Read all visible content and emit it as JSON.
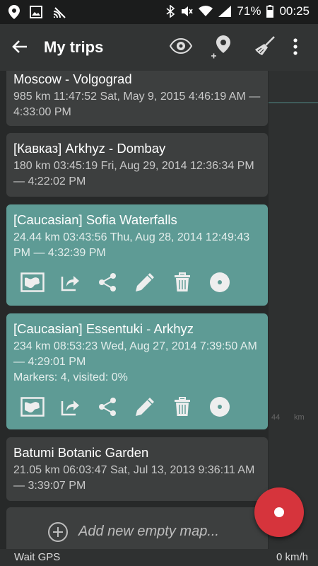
{
  "status": {
    "battery": "71%",
    "time": "00:25"
  },
  "header": {
    "title": "My trips"
  },
  "trips": [
    {
      "name": "Moscow - Volgograd",
      "meta": "985 km   11:47:52  Sat, May 9, 2015 4:46:19 AM — 4:33:00 PM"
    },
    {
      "name": "[Кавказ] Arkhyz - Dombay",
      "meta": "180 km   03:45:19  Fri, Aug 29, 2014 12:36:34 PM — 4:22:02 PM"
    },
    {
      "name": "[Caucasian] Sofia Waterfalls",
      "meta": "24.44 km   03:43:56  Thu, Aug 28, 2014 12:49:43 PM — 4:32:39 PM"
    },
    {
      "name": "[Caucasian] Essentuki - Arkhyz",
      "meta": "234 km   08:53:23  Wed, Aug 27, 2014 7:39:50 AM — 4:29:01 PM",
      "markers": "Markers: 4, visited: 0%"
    },
    {
      "name": "Batumi Botanic Garden",
      "meta": "21.05 km   06:03:47  Sat, Jul 13, 2013 9:36:11 AM — 3:39:07 PM"
    }
  ],
  "add_map": {
    "label": "Add new empty map..."
  },
  "map_axis": {
    "tick": "44",
    "unit": "km"
  },
  "footer": {
    "gps": "Wait GPS",
    "speed": "0 km/h"
  },
  "colors": {
    "selected_card": "#5e9b95",
    "card": "#3d3f3f",
    "fab": "#d6343c"
  }
}
